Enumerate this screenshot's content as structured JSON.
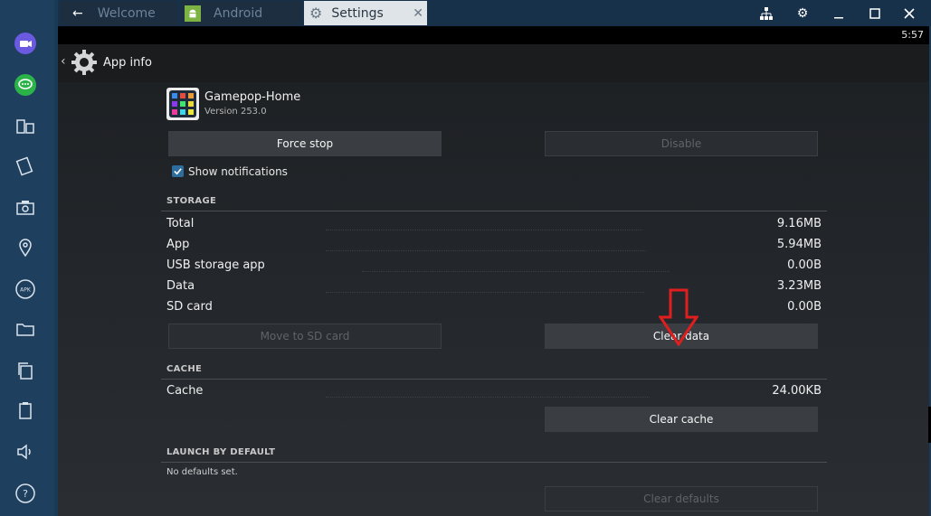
{
  "tabs": [
    {
      "label": "Welcome",
      "icon": "back-arrow-icon",
      "state": "inactive"
    },
    {
      "label": "Android",
      "icon": "android-icon",
      "state": "inactive"
    },
    {
      "label": "Settings",
      "icon": "gear-icon",
      "state": "active"
    }
  ],
  "window_controls": [
    "network-icon",
    "gear-icon",
    "minimize-icon",
    "maximize-icon",
    "close-icon"
  ],
  "sidebar": {
    "items": [
      {
        "name": "video-camera-icon"
      },
      {
        "name": "chat-icon"
      },
      {
        "name": "multi-window-icon"
      },
      {
        "name": "rotate-icon"
      },
      {
        "name": "camera-icon"
      },
      {
        "name": "location-icon"
      },
      {
        "name": "apk-icon",
        "label": "APK"
      },
      {
        "name": "folder-icon"
      },
      {
        "name": "copy-icon"
      },
      {
        "name": "clipboard-icon"
      },
      {
        "name": "volume-icon"
      },
      {
        "name": "help-icon",
        "label": "?"
      }
    ]
  },
  "status_bar": {
    "time": "5:57"
  },
  "action_bar": {
    "title": "App info"
  },
  "app": {
    "name": "Gamepop-Home",
    "version": "Version 253.0"
  },
  "buttons": {
    "force_stop": "Force stop",
    "disable": "Disable",
    "move_to_sd": "Move to SD card",
    "clear_data": "Clear data",
    "clear_cache": "Clear cache",
    "clear_defaults": "Clear defaults"
  },
  "show_notifications": {
    "label": "Show notifications",
    "checked": true
  },
  "storage": {
    "header": "STORAGE",
    "rows": [
      {
        "label": "Total",
        "value": "9.16MB"
      },
      {
        "label": "App",
        "value": "5.94MB"
      },
      {
        "label": "USB storage app",
        "value": "0.00B"
      },
      {
        "label": "Data",
        "value": "3.23MB"
      },
      {
        "label": "SD card",
        "value": "0.00B"
      }
    ]
  },
  "cache": {
    "header": "CACHE",
    "rows": [
      {
        "label": "Cache",
        "value": "24.00KB"
      }
    ]
  },
  "launch": {
    "header": "LAUNCH BY DEFAULT",
    "text": "No defaults set."
  },
  "colors": {
    "accent_arrow": "#e01e1e",
    "checkbox": "#2e6e9e",
    "sidebar": "#1f3f5f"
  }
}
